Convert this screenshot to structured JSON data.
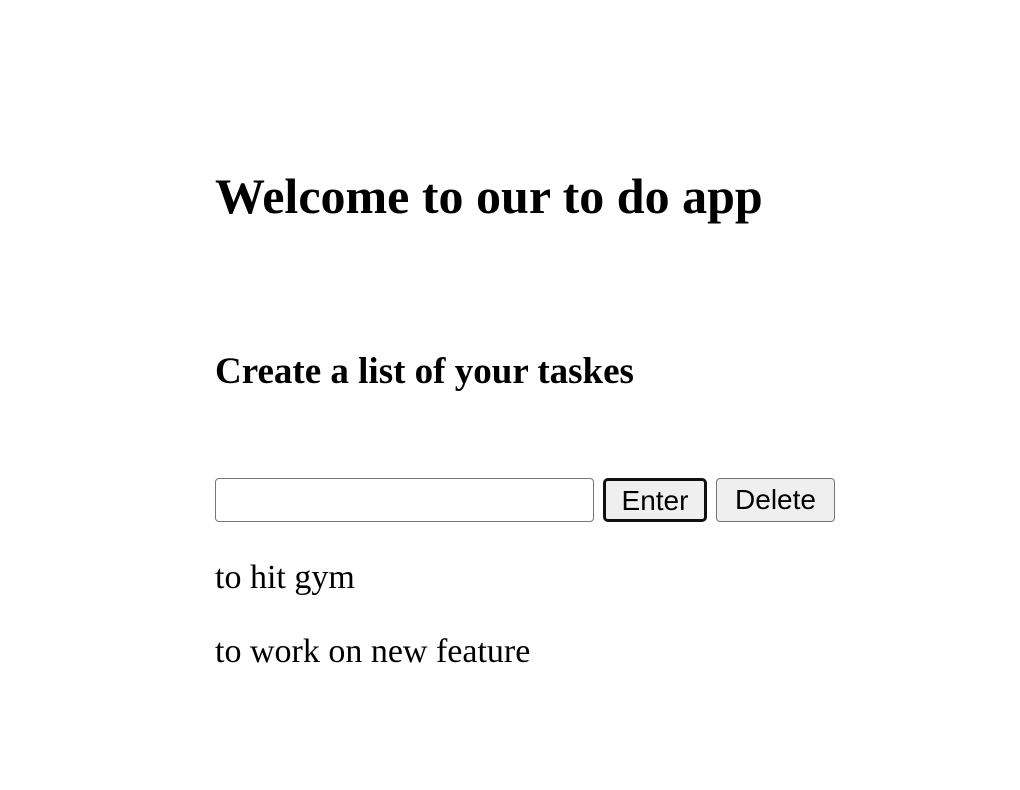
{
  "header": {
    "title": "Welcome to our to do app",
    "subtitle": "Create a list of your taskes"
  },
  "form": {
    "input_value": "",
    "input_placeholder": "",
    "enter_label": "Enter",
    "delete_label": "Delete"
  },
  "tasks": [
    "to hit gym",
    "to work on new feature"
  ]
}
